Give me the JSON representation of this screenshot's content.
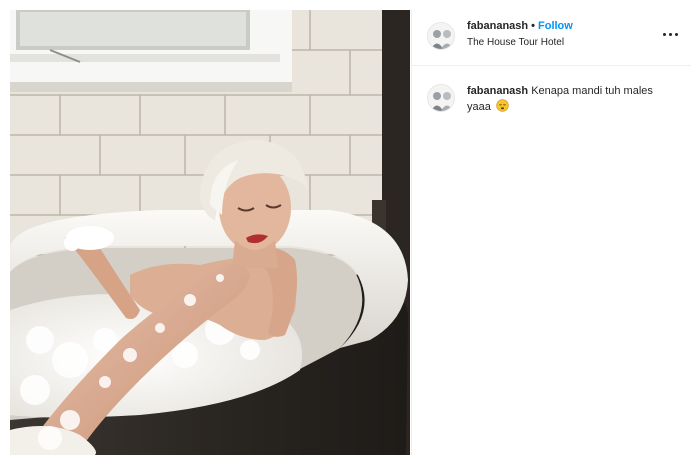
{
  "post": {
    "photo": {
      "icon": "bathtub-photo",
      "colors": {
        "wall": "#e9e4dc",
        "grout": "#bdb5a8",
        "tub": "#f4f2ee",
        "window_frame": "#f7f7f5",
        "hair": "#eeeae2",
        "skin": "#e2b79d",
        "lips": "#b0302e",
        "dark_wall": "#2c2622"
      }
    },
    "header": {
      "username": "fabananash",
      "separator": "•",
      "follow_label": "Follow",
      "location": "The House Tour Hotel",
      "more_icon": "ellipsis-icon"
    },
    "comment": {
      "username": "fabananash",
      "text": "Kenapa mandi tuh males yaaa",
      "emoji": "sleepy-face-emoji"
    },
    "colors": {
      "accent": "#0095f6",
      "text": "#262626",
      "divider": "#efefef"
    }
  }
}
